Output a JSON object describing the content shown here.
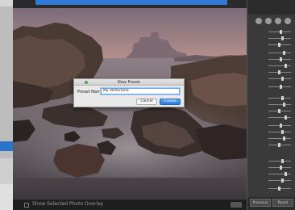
{
  "dialog": {
    "title": "New Preset",
    "field_label": "Preset Name:",
    "field_value": "My Vertorama",
    "cancel_label": "Cancel",
    "create_label": "Create"
  },
  "bottom_bar": {
    "checkbox_label": "Show Selected Photo Overlay"
  },
  "right_panel": {
    "footer_left": "Previous",
    "footer_right": "Reset"
  },
  "colors": {
    "accent": "#2f7ad6",
    "dialog_bg": "#e9e9e9",
    "panel_bg": "#3a3a3a"
  },
  "icons": [
    "checkbox-icon",
    "window-close-dot-icon",
    "tool-icon"
  ]
}
